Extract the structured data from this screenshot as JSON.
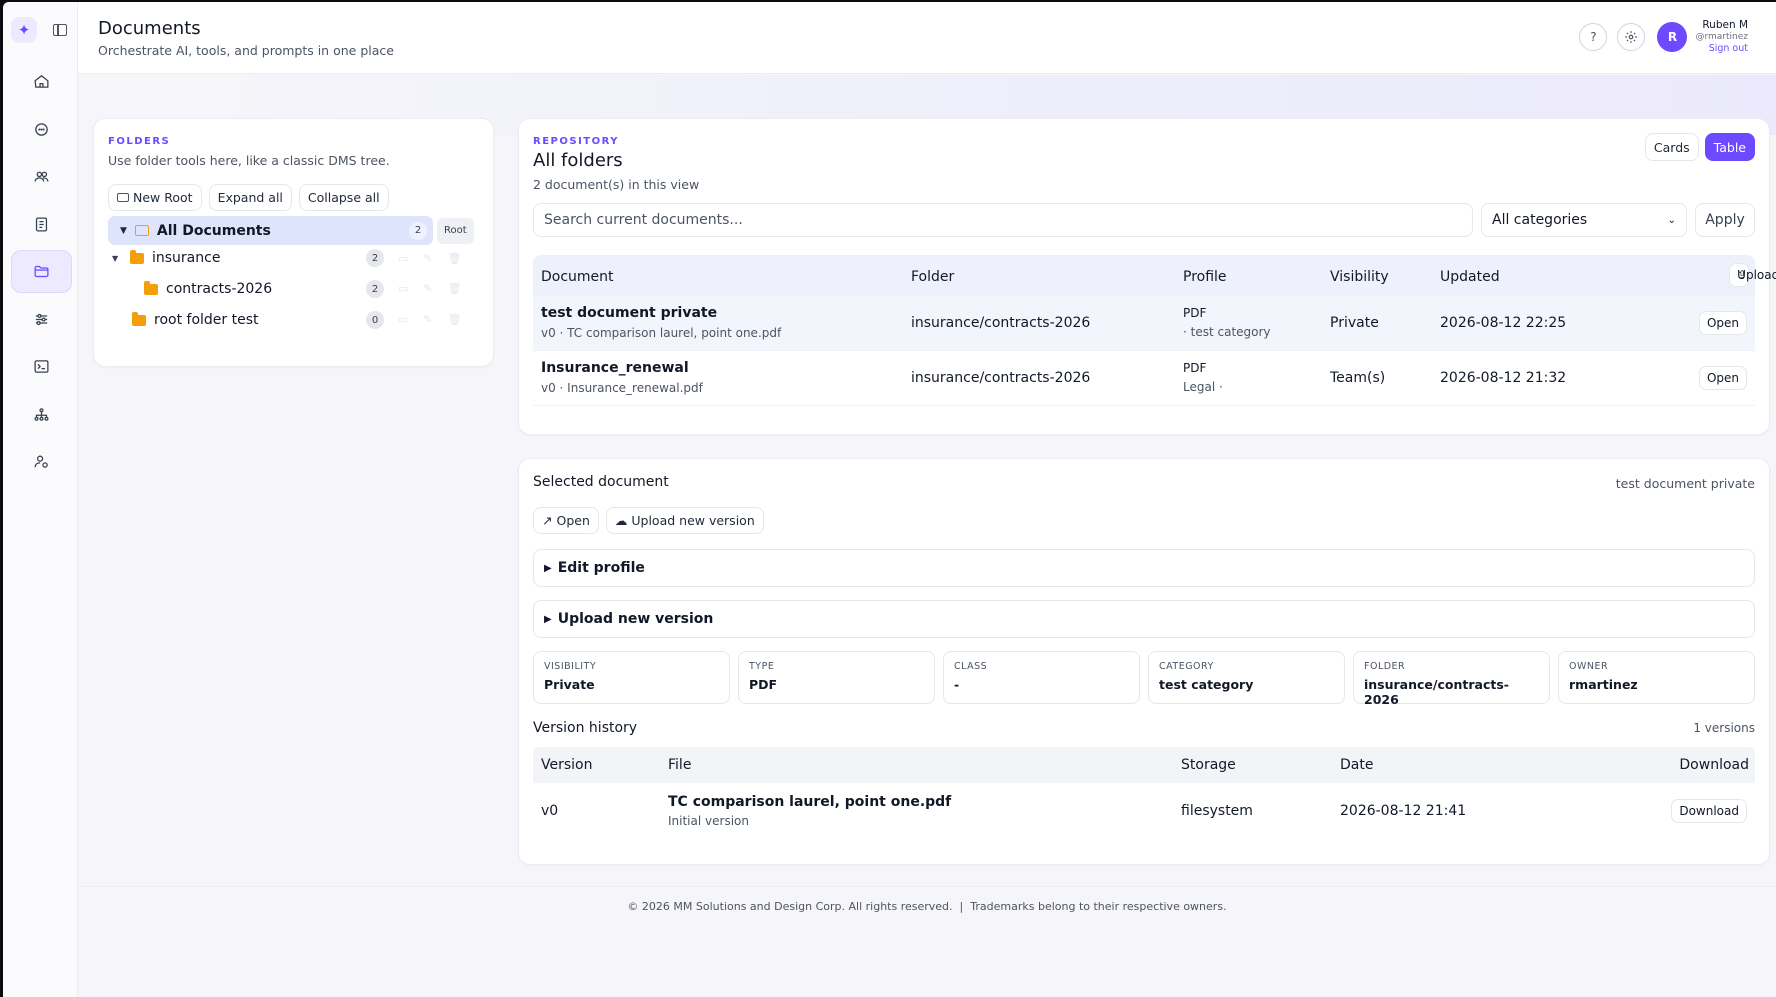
{
  "header": {
    "title": "Documents",
    "subtitle": "Orchestrate AI, tools, and prompts in one place",
    "user": {
      "initial": "R",
      "name": "Ruben M",
      "handle": "@rmartinez",
      "sign_out": "Sign out"
    }
  },
  "sidebar": {
    "items": [
      {
        "icon": "home-icon"
      },
      {
        "icon": "chat-icon"
      },
      {
        "icon": "users-icon"
      },
      {
        "icon": "notes-icon"
      },
      {
        "icon": "folder-icon",
        "active": true
      },
      {
        "icon": "sliders-icon"
      },
      {
        "icon": "terminal-icon"
      },
      {
        "icon": "hierarchy-icon"
      },
      {
        "icon": "user-settings-icon"
      }
    ]
  },
  "folders": {
    "eyebrow": "FOLDERS",
    "help": "Use folder tools here, like a classic DMS tree.",
    "tools": {
      "new_root": "New Root",
      "expand_all": "Expand all",
      "collapse_all": "Collapse all"
    },
    "root": {
      "label": "All Documents",
      "count": "2",
      "tag": "Root"
    },
    "tree": [
      {
        "label": "insurance",
        "count": "2"
      },
      {
        "label": "contracts-2026",
        "count": "2"
      },
      {
        "label": "root folder test",
        "count": "0"
      }
    ]
  },
  "repository": {
    "eyebrow": "REPOSITORY",
    "title": "All folders",
    "count_text": "2 document(s) in this view",
    "view_cards": "Cards",
    "view_table": "Table",
    "search_placeholder": "Search current documents...",
    "category": "All categories",
    "apply": "Apply",
    "columns": {
      "document": "Document",
      "folder": "Folder",
      "profile": "Profile",
      "visibility": "Visibility",
      "updated": "Updated",
      "upload": "Upload"
    },
    "rows": [
      {
        "name": "test document private",
        "sub": "v0 · TC comparison laurel, point one.pdf",
        "folder": "insurance/contracts-2026",
        "profile": "PDF",
        "profile_sub": "· test category",
        "visibility": "Private",
        "updated": "2026-08-12 22:25",
        "action": "Open"
      },
      {
        "name": "Insurance_renewal",
        "sub": "v0 · Insurance_renewal.pdf",
        "folder": "insurance/contracts-2026",
        "profile": "PDF",
        "profile_sub": "Legal ·",
        "visibility": "Team(s)",
        "updated": "2026-08-12 21:32",
        "action": "Open"
      }
    ]
  },
  "selected": {
    "title": "Selected document",
    "name": "test document private",
    "open": "Open",
    "upload_version": "Upload new version",
    "edit_profile": "Edit profile",
    "upload_section": "Upload new version",
    "meta": [
      {
        "k": "VISIBILITY",
        "v": "Private"
      },
      {
        "k": "TYPE",
        "v": "PDF"
      },
      {
        "k": "CLASS",
        "v": "-"
      },
      {
        "k": "CATEGORY",
        "v": "test category"
      },
      {
        "k": "FOLDER",
        "v": "insurance/contracts-2026"
      },
      {
        "k": "OWNER",
        "v": "rmartinez"
      }
    ],
    "history_title": "Version history",
    "history_count": "1 versions",
    "ver_columns": {
      "version": "Version",
      "file": "File",
      "storage": "Storage",
      "date": "Date",
      "download": "Download"
    },
    "versions": [
      {
        "version": "v0",
        "file": "TC comparison laurel, point one.pdf",
        "note": "Initial version",
        "storage": "filesystem",
        "date": "2026-08-12 21:41",
        "action": "Download"
      }
    ]
  },
  "footer": {
    "copyright": "© 2026 MM Solutions and Design Corp. All rights reserved.",
    "separator": "|",
    "trademark": "Trademarks belong to their respective owners."
  },
  "colors": {
    "accent": "#6d4aff",
    "folder": "#f59e0b"
  }
}
